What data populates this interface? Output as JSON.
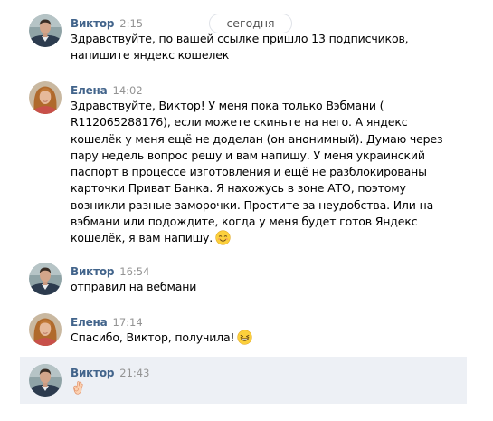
{
  "date_separator": "сегодня",
  "messages": [
    {
      "author": "Виктор",
      "time": "2:15",
      "lines": [
        "Здравствуйте, по вашей ссылке пришло 13 подписчиков,",
        "напишите яндекс кошелек"
      ],
      "avatar": "man-avatar"
    },
    {
      "author": "Елена",
      "time": "14:02",
      "lines": [
        "Здравствуйте, Виктор! У меня пока только Вэбмани (",
        "R112065288176), если можете скиньте на него. А яндекс",
        "кошелёк у меня ещё не доделан (он анонимный). Думаю через",
        "пару недель вопрос решу и вам напишу. У меня украинский",
        "паспорт в процессе изготовления и ещё не разблокированы",
        "карточки Приват Банка. Я нахожусь в зоне АТО, поэтому",
        "возникли разные заморочки. Простите за неудобства. Или на",
        "вэбмани или подождите, когда у меня будет готов Яндекс",
        "кошелёк, я вам напишу."
      ],
      "avatar": "woman-avatar",
      "emoji": "blush-emoji"
    },
    {
      "author": "Виктор",
      "time": "16:54",
      "lines": [
        "отправил на вебмани"
      ],
      "avatar": "man-avatar"
    },
    {
      "author": "Елена",
      "time": "17:14",
      "lines": [
        "Спасибо, Виктор, получила!"
      ],
      "avatar": "woman-avatar",
      "emoji": "grin-emoji"
    },
    {
      "author": "Виктор",
      "time": "21:43",
      "lines": [],
      "avatar": "man-avatar",
      "emoji": "ok-hand-emoji",
      "highlighted": true
    }
  ],
  "colors": {
    "author": "#42648b",
    "time": "#939393",
    "highlight_bg": "#edf0f5"
  }
}
